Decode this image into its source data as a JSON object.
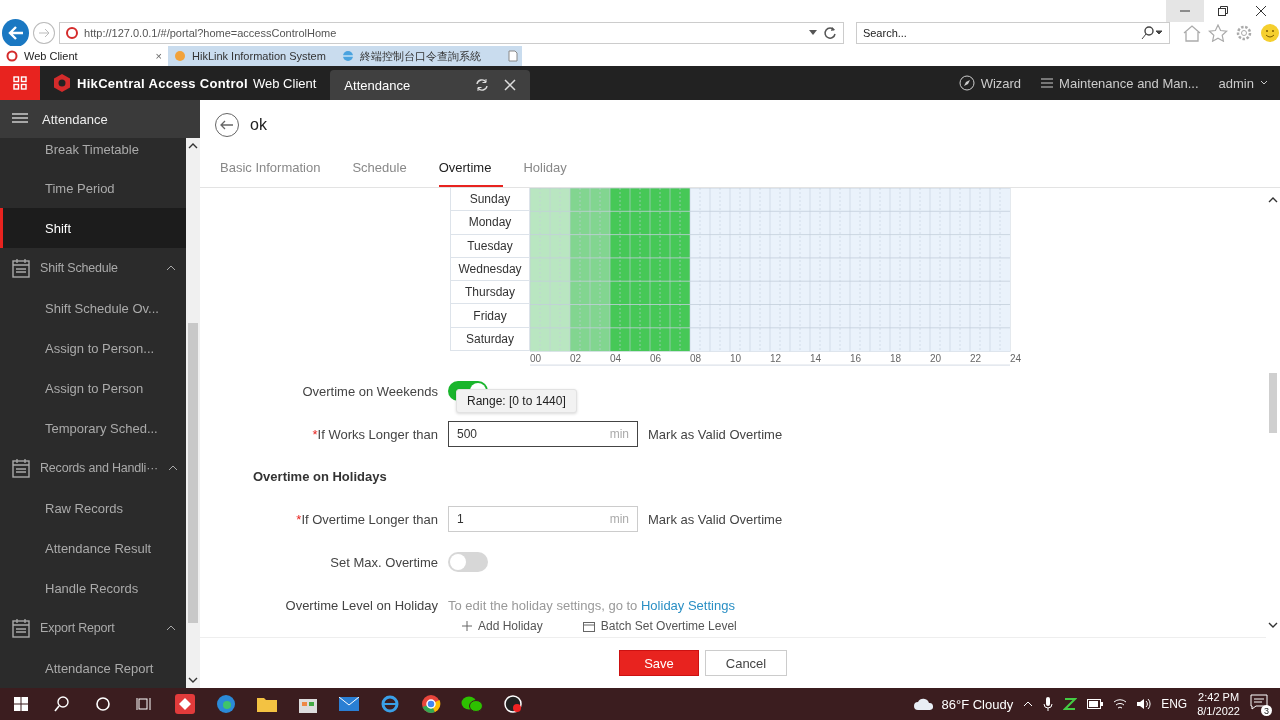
{
  "browser": {
    "address": "http://127.0.0.1/#/portal?home=accessControlHome",
    "search_placeholder": "Search...",
    "tabs": [
      {
        "label": "Web Client",
        "selected": true,
        "close": "×"
      },
      {
        "label": "HikLink Information System",
        "selected": false
      },
      {
        "label": "終端控制台口令查詢系統",
        "selected": false
      }
    ]
  },
  "app_header": {
    "brand": "HikCentral Access Control",
    "product": "Web Client",
    "module_tab": "Attendance",
    "wizard": "Wizard",
    "maintenance": "Maintenance and Man...",
    "user": "admin"
  },
  "sidebar": {
    "title": "Attendance",
    "items": [
      {
        "kind": "item",
        "label": "Break Timetable",
        "selected": false
      },
      {
        "kind": "item",
        "label": "Time Period",
        "selected": false
      },
      {
        "kind": "item",
        "label": "Shift",
        "selected": true
      },
      {
        "kind": "group",
        "label": "Shift Schedule",
        "expanded": true
      },
      {
        "kind": "item",
        "label": "Shift Schedule Ov...",
        "selected": false
      },
      {
        "kind": "item",
        "label": "Assign to Person...",
        "selected": false
      },
      {
        "kind": "item",
        "label": "Assign to Person",
        "selected": false
      },
      {
        "kind": "item",
        "label": "Temporary Sched...",
        "selected": false
      },
      {
        "kind": "group",
        "label": "Records and Handli···",
        "expanded": true
      },
      {
        "kind": "item",
        "label": "Raw Records",
        "selected": false
      },
      {
        "kind": "item",
        "label": "Attendance Result",
        "selected": false
      },
      {
        "kind": "item",
        "label": "Handle Records",
        "selected": false
      },
      {
        "kind": "group",
        "label": "Export Report",
        "expanded": true
      },
      {
        "kind": "item",
        "label": "Attendance Report",
        "selected": false
      }
    ]
  },
  "page": {
    "title": "ok",
    "tabs": [
      {
        "label": "Basic Information",
        "selected": false
      },
      {
        "label": "Schedule",
        "selected": false
      },
      {
        "label": "Overtime",
        "selected": true
      },
      {
        "label": "Holiday",
        "selected": false
      }
    ]
  },
  "schedule": {
    "days": [
      "Sunday",
      "Monday",
      "Tuesday",
      "Wednesday",
      "Thursday",
      "Friday",
      "Saturday"
    ],
    "hour_ticks": [
      "00",
      "02",
      "04",
      "06",
      "08",
      "10",
      "12",
      "14",
      "16",
      "18",
      "20",
      "22",
      "24"
    ],
    "hours": [
      {
        "kind": "light"
      },
      {
        "kind": "light"
      },
      {
        "kind": "medium"
      },
      {
        "kind": "medium"
      },
      {
        "kind": "full"
      },
      {
        "kind": "full"
      },
      {
        "kind": "full"
      },
      {
        "kind": "full"
      },
      {
        "kind": "none"
      },
      {
        "kind": "none"
      },
      {
        "kind": "none"
      },
      {
        "kind": "none"
      },
      {
        "kind": "none"
      },
      {
        "kind": "none"
      },
      {
        "kind": "none"
      },
      {
        "kind": "none"
      },
      {
        "kind": "none"
      },
      {
        "kind": "none"
      },
      {
        "kind": "none"
      },
      {
        "kind": "none"
      },
      {
        "kind": "none"
      },
      {
        "kind": "none"
      },
      {
        "kind": "none"
      },
      {
        "kind": "none"
      }
    ]
  },
  "form": {
    "weekends_label": "Overtime on Weekends",
    "weekends_on": true,
    "tooltip": "Range: [0 to 1440]",
    "works_label": "If Works Longer than",
    "works_value": "500",
    "works_unit": "min",
    "works_note": "Mark as Valid Overtime",
    "required": "*",
    "holidays_heading": "Overtime on Holidays",
    "holiday_label": "If Overtime Longer than",
    "holiday_value": "1",
    "holiday_unit": "min",
    "holiday_note": "Mark as Valid Overtime",
    "max_label": "Set Max. Overtime",
    "max_on": false,
    "level_label": "Overtime Level on Holiday",
    "level_text": "To edit the holiday settings, go to",
    "level_link": "Holiday Settings",
    "add_holiday": "Add Holiday",
    "batch_set": "Batch Set Overtime Level"
  },
  "footer": {
    "save": "Save",
    "cancel": "Cancel"
  },
  "taskbar": {
    "weather": "86°F Cloudy",
    "language": "ENG",
    "time": "2:42 PM",
    "date": "8/1/2022",
    "notifications": "3"
  }
}
